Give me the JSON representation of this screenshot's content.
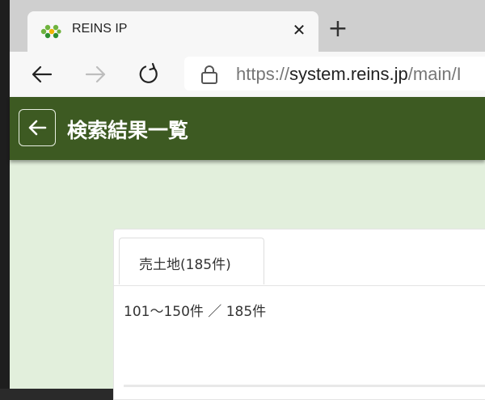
{
  "browser": {
    "tab_title": "REINS IP",
    "close_glyph": "✕",
    "new_tab_glyph": "+",
    "url_prefix": "https://",
    "url_host": "system.reins.jp",
    "url_path": "/main/I"
  },
  "header": {
    "title": "検索結果一覧",
    "color": "#3d5a22"
  },
  "results": {
    "tab_label": "売土地(185件)",
    "count_text": "101〜150件 ／ 185件"
  },
  "icons": {
    "favicon": "reins-logo-icon",
    "back": "arrow-left-icon",
    "forward": "arrow-right-icon",
    "reload": "reload-icon",
    "lock": "lock-icon"
  }
}
